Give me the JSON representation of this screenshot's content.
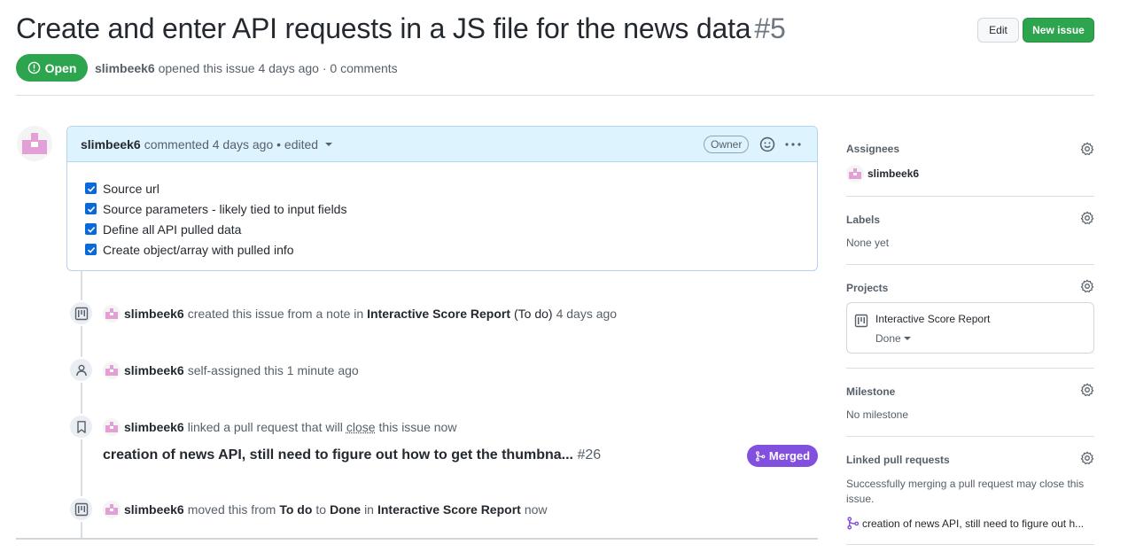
{
  "issue": {
    "title": "Create and enter API requests in a JS file for the news data",
    "number": "#5",
    "state": "Open",
    "author": "slimbeek6",
    "meta_rest": "opened this issue 4 days ago · 0 comments"
  },
  "actions": {
    "edit": "Edit",
    "new_issue": "New issue"
  },
  "comment": {
    "author": "slimbeek6",
    "info": "commented 4 days ago • edited",
    "role_badge": "Owner",
    "tasks": [
      "Source url",
      "Source parameters - likely tied to input fields",
      "Define all API pulled data",
      "Create object/array with pulled info"
    ]
  },
  "timeline": [
    {
      "icon": "project-icon",
      "actor": "slimbeek6",
      "pre": "created this issue from a note in",
      "target": "Interactive Score Report",
      "extra": "(To do)",
      "time": "4 days ago"
    },
    {
      "icon": "person-icon",
      "actor": "slimbeek6",
      "text": "self-assigned this 1 minute ago"
    },
    {
      "icon": "bookmark-icon",
      "actor": "slimbeek6",
      "pre": "linked a pull request that will",
      "link": "close",
      "post": "this issue now",
      "pr_title": "creation of news API, still need to figure out how to get the thumbna...",
      "pr_number": "#26",
      "pr_state": "Merged"
    },
    {
      "icon": "project-icon",
      "actor": "slimbeek6",
      "pre": "moved this from",
      "from": "To do",
      "mid": "to",
      "to": "Done",
      "in": "in",
      "project": "Interactive Score Report",
      "time": "now"
    }
  ],
  "sidebar": {
    "assignees": {
      "heading": "Assignees",
      "value": "slimbeek6"
    },
    "labels": {
      "heading": "Labels",
      "value": "None yet"
    },
    "projects": {
      "heading": "Projects",
      "name": "Interactive Score Report",
      "status": "Done"
    },
    "milestone": {
      "heading": "Milestone",
      "value": "No milestone"
    },
    "linked_prs": {
      "heading": "Linked pull requests",
      "note": "Successfully merging a pull request may close this issue.",
      "item": "creation of news API, still need to figure out h..."
    }
  },
  "colors": {
    "open_green": "#2da44e",
    "merged_purple": "#8250df",
    "comment_header": "#ddf4ff",
    "checkbox_blue": "#0969da",
    "avatar_pink": "#e3a0d6"
  }
}
